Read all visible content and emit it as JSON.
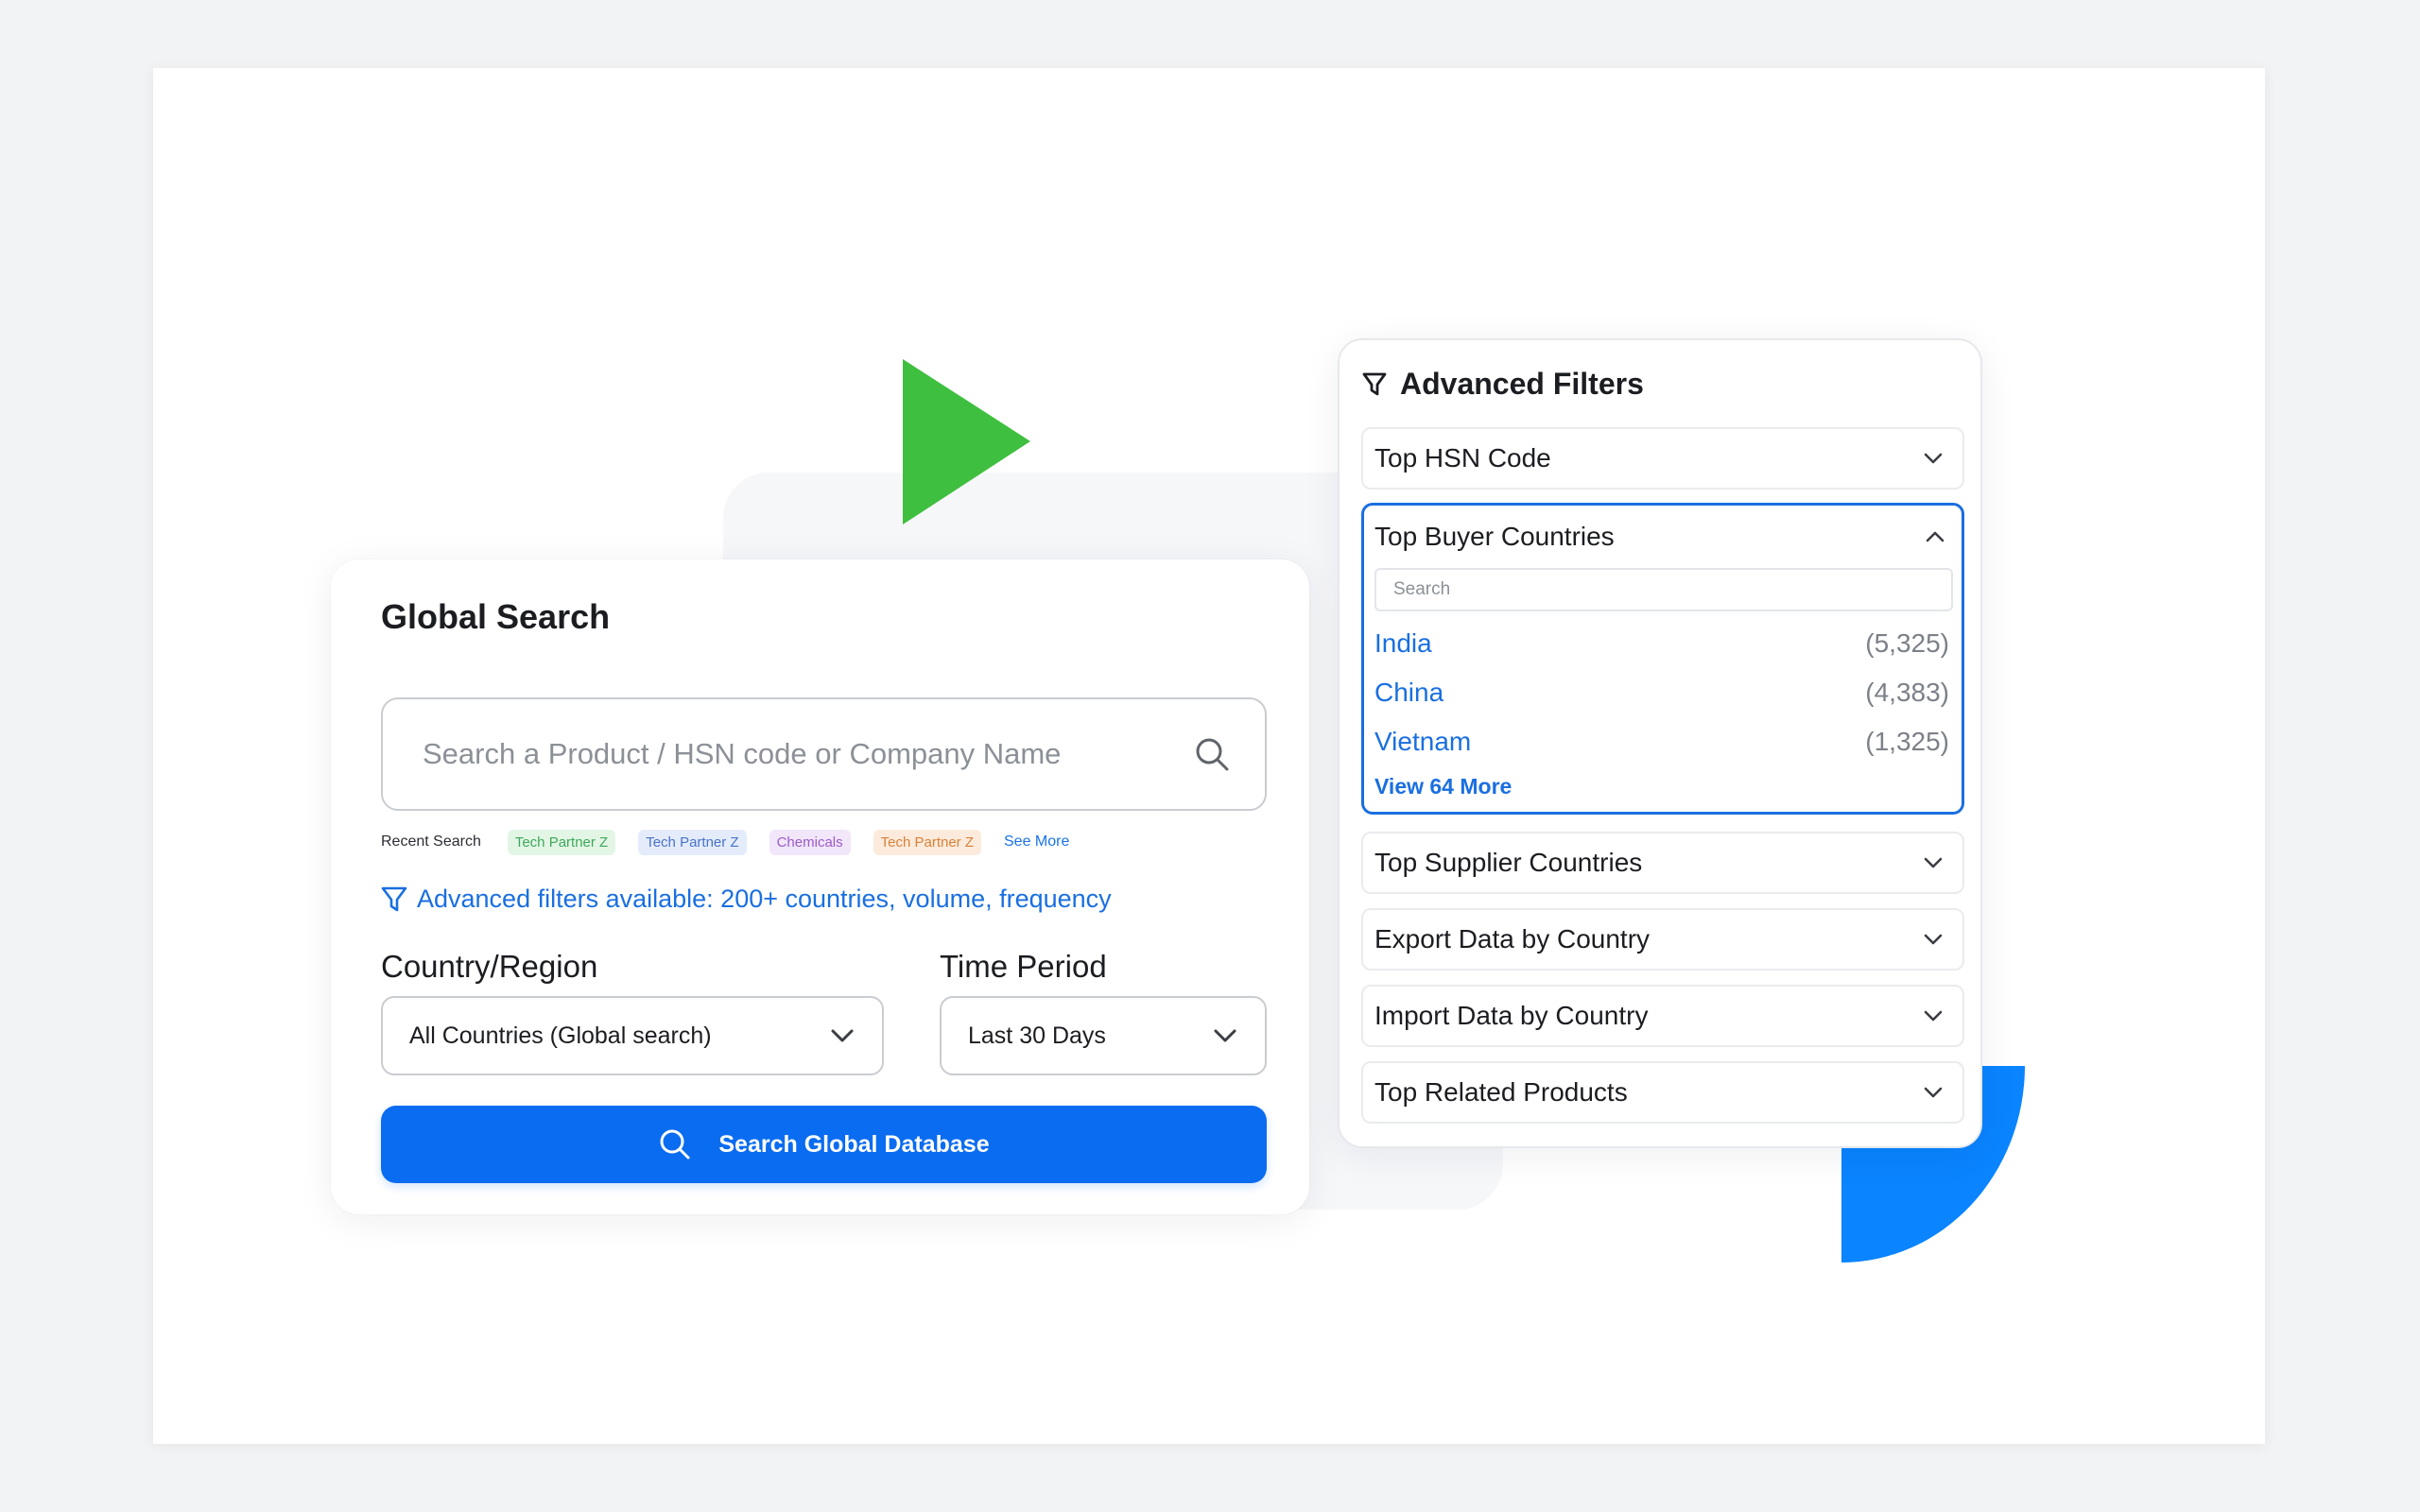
{
  "colors": {
    "accent_blue": "#0a6cf0",
    "link_blue": "#1a6fe0",
    "play_green": "#3fbf3f",
    "shape_blue": "#0a84ff"
  },
  "global_search": {
    "title": "Global Search",
    "search_placeholder": "Search a Product / HSN code or Company Name",
    "search_icon": "search-icon",
    "recent_label": "Recent Search",
    "recent_chips": [
      {
        "label": "Tech Partner Z",
        "bg": "#e3f6e6",
        "fg": "#3fa85a"
      },
      {
        "label": "Tech Partner Z",
        "bg": "#e4ecfb",
        "fg": "#4a72c9"
      },
      {
        "label": "Chemicals",
        "bg": "#f2e6fb",
        "fg": "#9a5cc6"
      },
      {
        "label": "Tech Partner Z",
        "bg": "#fcebdc",
        "fg": "#d9803a"
      }
    ],
    "see_more": "See More",
    "advanced_note": "Advanced filters available: 200+ countries, volume, frequency",
    "country_label": "Country/Region",
    "country_value": "All Countries (Global search)",
    "period_label": "Time Period",
    "period_value": "Last 30 Days",
    "search_button": "Search Global Database"
  },
  "filters": {
    "title": "Advanced Filters",
    "top_hsn": "Top HSN Code",
    "buyer": {
      "title": "Top Buyer Countries",
      "search_placeholder": "Search",
      "countries": [
        {
          "name": "India",
          "count": "(5,325)"
        },
        {
          "name": "China",
          "count": "(4,383)"
        },
        {
          "name": "Vietnam",
          "count": "(1,325)"
        }
      ],
      "view_more": "View 64 More"
    },
    "supplier": "Top Supplier Countries",
    "export": "Export Data by Country",
    "import": "Import Data by Country",
    "related": "Top Related Products"
  }
}
